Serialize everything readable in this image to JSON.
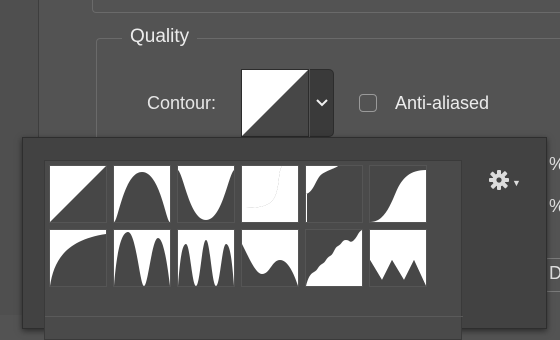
{
  "panel": {
    "group_title": "Quality",
    "contour_label": "Contour:",
    "anti_aliased_label": "Anti-aliased",
    "anti_aliased_checked": false,
    "dropdown_icon": "chevron-down-icon",
    "right_fragments": {
      "percent_1": "%",
      "percent_2": "%",
      "edge_letter": "D"
    }
  },
  "picker": {
    "settings_icon": "gear-icon",
    "presets": [
      "linear",
      "cone",
      "cove-deep",
      "cove-shallow",
      "gaussian",
      "half-round",
      "ring",
      "ring-double",
      "rolling-slope-descending",
      "rounded-steps",
      "sawtooth",
      "ring-triple"
    ]
  }
}
